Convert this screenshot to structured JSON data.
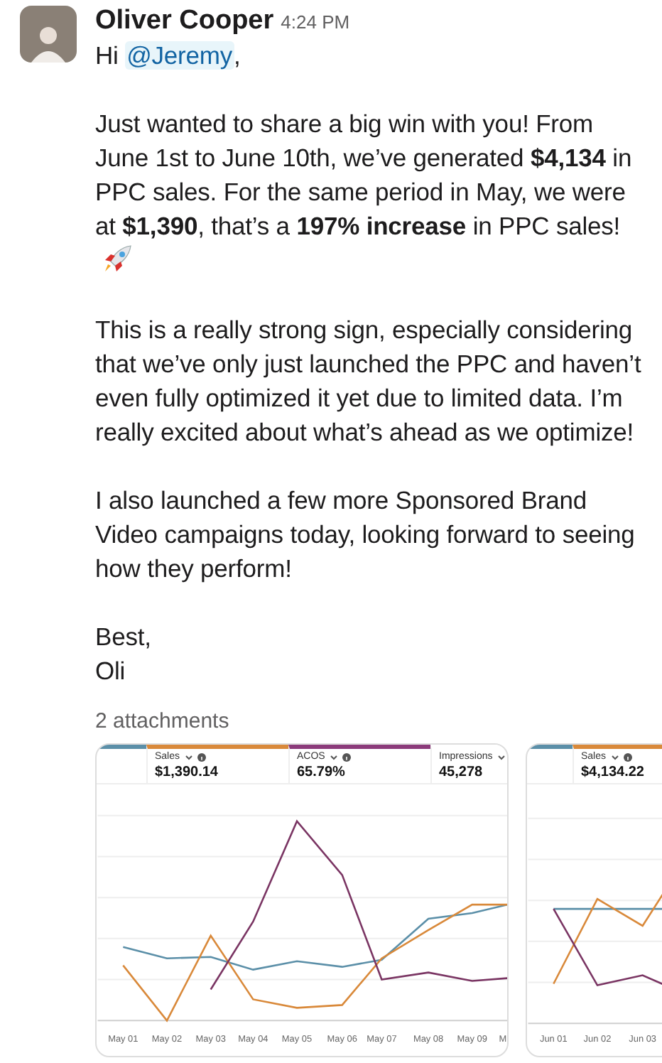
{
  "author": "Oliver Cooper",
  "time": "4:24 PM",
  "greeting": {
    "before": "Hi ",
    "mention": "@Jeremy",
    "after": ","
  },
  "paragraphs": [
    {
      "text": "Just wanted to share a big win with you! From June 1st to June 10th, we’ve generated **$4,134** in PPC sales. For the same period in May, we were at **$1,390**, that’s a **197% increase** in PPC sales!",
      "rocket": true
    },
    {
      "text": "This is a really strong sign, especially considering that we’ve only just launched the PPC and haven’t even fully optimized it yet due to limited data. I’m really excited about what’s ahead as we optimize!",
      "rocket": false
    },
    {
      "text": "I also launched a few more Sponsored Brand Video campaigns today, looking forward to seeing how they perform!",
      "rocket": false
    }
  ],
  "signoff": [
    "Best,",
    "Oli"
  ],
  "attachments_label": "2 attachments",
  "attachments": [
    {
      "metrics": [
        {
          "label": "Sales",
          "value": "$1,390.14",
          "color": "#d9893a"
        },
        {
          "label": "ACOS",
          "value": "65.79%",
          "color": "#8b3a7a"
        },
        {
          "label": "Impressions",
          "value": "45,278",
          "color": "#ffffff"
        }
      ],
      "x_labels": [
        "May 01",
        "May 02",
        "May 03",
        "May 04",
        "May 05",
        "May 06",
        "May 07",
        "May 08",
        "May 09",
        "M"
      ]
    },
    {
      "metrics": [
        {
          "label": "Sales",
          "value": "$4,134.22",
          "color": "#d9893a"
        }
      ],
      "x_labels": [
        "Jun 01",
        "Jun 02",
        "Jun 03"
      ]
    }
  ]
}
